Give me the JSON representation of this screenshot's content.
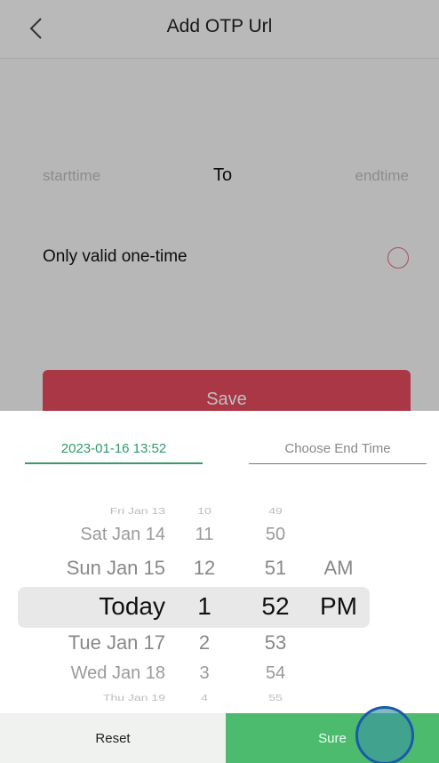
{
  "nav": {
    "back_icon": "chevron-left-icon",
    "title": "Add OTP Url"
  },
  "time_range": {
    "start_placeholder": "starttime",
    "separator": "To",
    "end_placeholder": "endtime"
  },
  "one_time": {
    "label": "Only valid one-time",
    "checked": false
  },
  "save_button": "Save",
  "picker": {
    "tabs": {
      "start_value": "2023-01-16 13:52",
      "end_label": "Choose End Time"
    },
    "dates": [
      "Fri Jan 13",
      "Sat Jan 14",
      "Sun Jan 15",
      "Today",
      "Tue Jan 17",
      "Wed Jan 18",
      "Thu Jan 19"
    ],
    "hours": [
      "10",
      "11",
      "12",
      "1",
      "2",
      "3",
      "4"
    ],
    "minutes": [
      "49",
      "50",
      "51",
      "52",
      "53",
      "54",
      "55"
    ],
    "ampm": [
      "AM",
      "PM"
    ]
  },
  "footer": {
    "reset": "Reset",
    "sure": "Sure"
  },
  "colors": {
    "accent_green": "#4cbb6e",
    "save_red": "#e24a5e",
    "start_tab_green": "#2e9a6a"
  }
}
